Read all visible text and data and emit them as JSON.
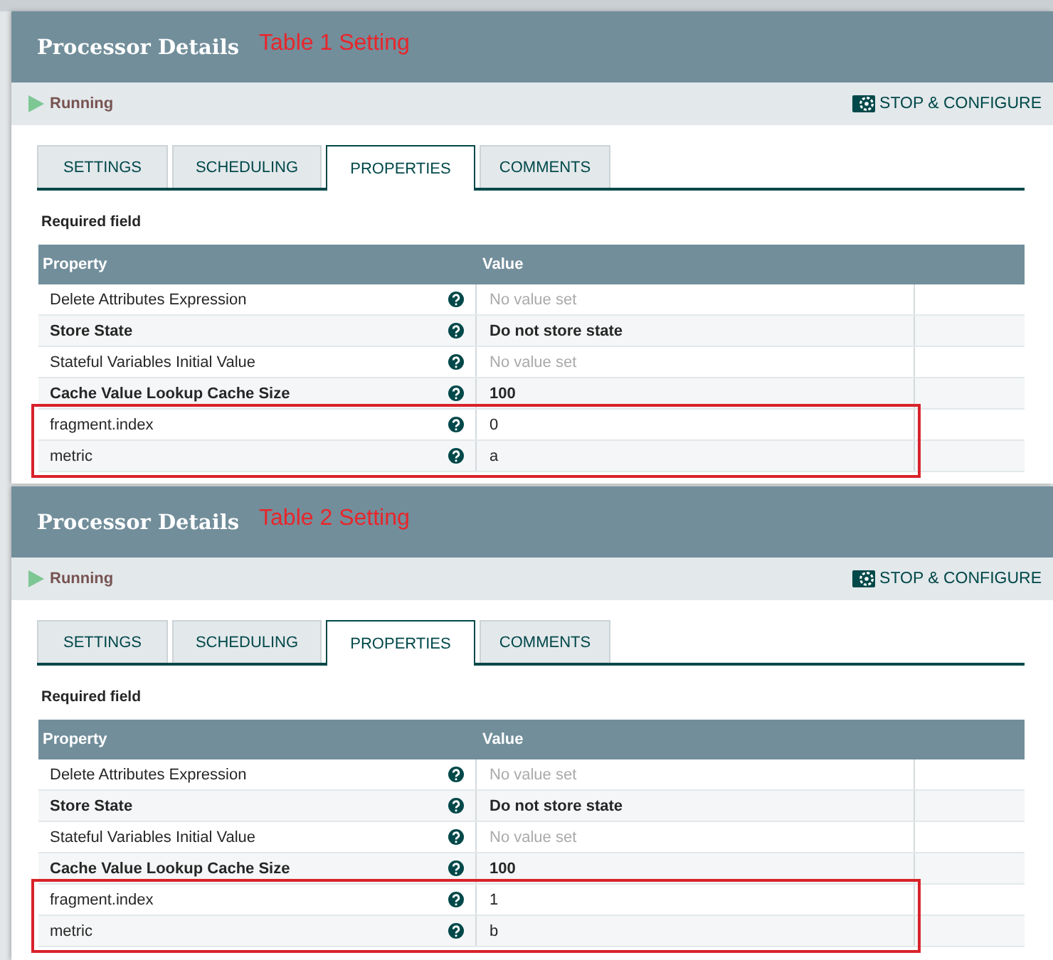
{
  "panels": [
    {
      "title": "Processor Details",
      "annotation": "Table 1 Setting",
      "status": "Running",
      "action": "STOP & CONFIGURE",
      "tabs": [
        {
          "label": "SETTINGS",
          "selected": false
        },
        {
          "label": "SCHEDULING",
          "selected": false
        },
        {
          "label": "PROPERTIES",
          "selected": true
        },
        {
          "label": "COMMENTS",
          "selected": false
        }
      ],
      "required_label": "Required field",
      "columns": [
        "Property",
        "Value"
      ],
      "rows": [
        {
          "property": "Delete Attributes Expression",
          "required": false,
          "value": "No value set",
          "unset": true,
          "highlighted": false
        },
        {
          "property": "Store State",
          "required": true,
          "value": "Do not store state",
          "unset": false,
          "highlighted": false
        },
        {
          "property": "Stateful Variables Initial Value",
          "required": false,
          "value": "No value set",
          "unset": true,
          "highlighted": false
        },
        {
          "property": "Cache Value Lookup Cache Size",
          "required": true,
          "value": "100",
          "unset": false,
          "highlighted": false
        },
        {
          "property": "fragment.index",
          "required": false,
          "value": "0",
          "unset": false,
          "highlighted": true
        },
        {
          "property": "metric",
          "required": false,
          "value": "a",
          "unset": false,
          "highlighted": true
        }
      ]
    },
    {
      "title": "Processor Details",
      "annotation": "Table 2 Setting",
      "status": "Running",
      "action": "STOP & CONFIGURE",
      "tabs": [
        {
          "label": "SETTINGS",
          "selected": false
        },
        {
          "label": "SCHEDULING",
          "selected": false
        },
        {
          "label": "PROPERTIES",
          "selected": true
        },
        {
          "label": "COMMENTS",
          "selected": false
        }
      ],
      "required_label": "Required field",
      "columns": [
        "Property",
        "Value"
      ],
      "rows": [
        {
          "property": "Delete Attributes Expression",
          "required": false,
          "value": "No value set",
          "unset": true,
          "highlighted": false
        },
        {
          "property": "Store State",
          "required": true,
          "value": "Do not store state",
          "unset": false,
          "highlighted": false
        },
        {
          "property": "Stateful Variables Initial Value",
          "required": false,
          "value": "No value set",
          "unset": true,
          "highlighted": false
        },
        {
          "property": "Cache Value Lookup Cache Size",
          "required": true,
          "value": "100",
          "unset": false,
          "highlighted": false
        },
        {
          "property": "fragment.index",
          "required": false,
          "value": "1",
          "unset": false,
          "highlighted": true
        },
        {
          "property": "metric",
          "required": false,
          "value": "b",
          "unset": false,
          "highlighted": true
        }
      ]
    }
  ]
}
